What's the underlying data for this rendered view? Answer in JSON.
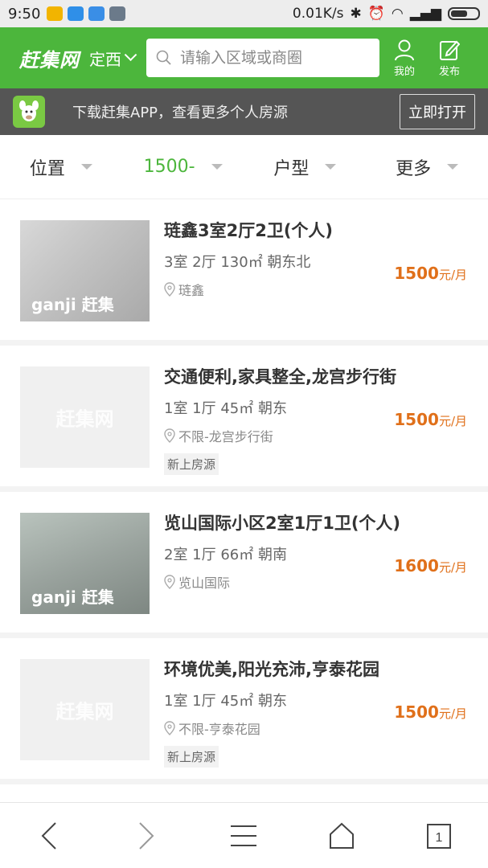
{
  "status": {
    "time": "9:50",
    "speed": "0.01K/s"
  },
  "header": {
    "logo": "赶集网",
    "city": "定西",
    "search_placeholder": "请输入区域或商圈",
    "mine_label": "我的",
    "post_label": "发布"
  },
  "banner": {
    "text": "下载赶集APP，查看更多个人房源",
    "open_label": "立即打开"
  },
  "filters": [
    {
      "label": "位置"
    },
    {
      "label": "1500-"
    },
    {
      "label": "户型"
    },
    {
      "label": "更多"
    }
  ],
  "listings": [
    {
      "title": "琏鑫3室2厅2卫(个人)",
      "spec": "3室 2厅  130㎡  朝东北",
      "location": "琏鑫",
      "price": "1500",
      "unit": "元/月",
      "tag": "",
      "thumb_watermark": "ganji 赶集"
    },
    {
      "title": "交通便利,家具整全,龙宫步行街",
      "spec": "1室 1厅  45㎡  朝东",
      "location": "不限-龙宫步行街",
      "price": "1500",
      "unit": "元/月",
      "tag": "新上房源",
      "thumb_watermark": "赶集网"
    },
    {
      "title": "览山国际小区2室1厅1卫(个人)",
      "spec": "2室 1厅  66㎡  朝南",
      "location": "览山国际",
      "price": "1600",
      "unit": "元/月",
      "tag": "",
      "thumb_watermark": "ganji 赶集"
    },
    {
      "title": "环境优美,阳光充沛,亨泰花园",
      "spec": "1室 1厅  45㎡  朝东",
      "location": "不限-亨泰花园",
      "price": "1500",
      "unit": "元/月",
      "tag": "新上房源",
      "thumb_watermark": "赶集网"
    }
  ],
  "bottom_nav": {
    "tab_count": "1"
  }
}
